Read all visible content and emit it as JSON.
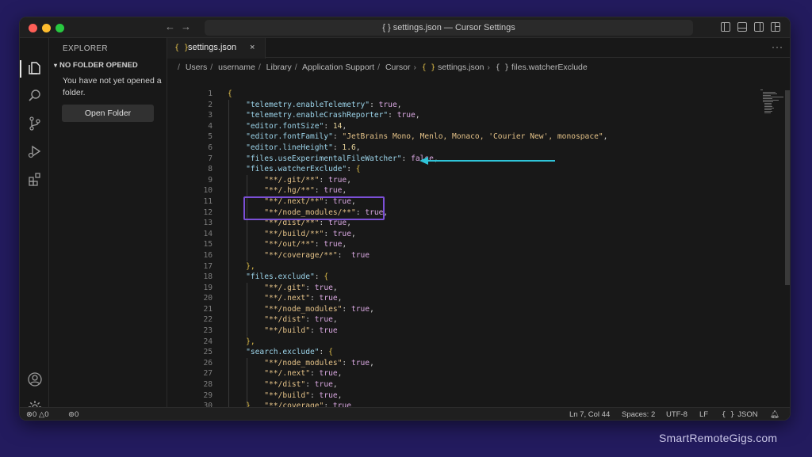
{
  "window": {
    "title": "{ } settings.json — Cursor Settings"
  },
  "sidebar": {
    "title": "EXPLORER",
    "section": "NO FOLDER OPENED",
    "message": "You have not yet opened a folder.",
    "open_folder_label": "Open Folder"
  },
  "tab": {
    "braces": "{ }",
    "name": "settings.json",
    "close": "×"
  },
  "breadcrumb": {
    "items": [
      "Users",
      "username",
      "Library",
      "Application Support",
      "Cursor",
      "settings.json",
      "files.watcherExclude"
    ],
    "leading_sep": "/",
    "sep": "/",
    "chevron": "›",
    "braces": "{ }"
  },
  "code_lines": [
    [
      [
        "br",
        "{"
      ]
    ],
    [
      [
        "p",
        "    "
      ],
      [
        "k",
        "\"telemetry.enableTelemetry\""
      ],
      [
        "p",
        ": "
      ],
      [
        "b",
        "true"
      ],
      [
        "p",
        ","
      ]
    ],
    [
      [
        "p",
        "    "
      ],
      [
        "k",
        "\"telemetry.enableCrashReporter\""
      ],
      [
        "p",
        ": "
      ],
      [
        "b",
        "true"
      ],
      [
        "p",
        ","
      ]
    ],
    [
      [
        "p",
        "    "
      ],
      [
        "k",
        "\"editor.fontSize\""
      ],
      [
        "p",
        ": "
      ],
      [
        "n",
        "14"
      ],
      [
        "p",
        ","
      ]
    ],
    [
      [
        "p",
        "    "
      ],
      [
        "k",
        "\"editor.fontFamily\""
      ],
      [
        "p",
        ": "
      ],
      [
        "s",
        "\"JetBrains Mono, Menlo, Monaco, 'Courier New', monospace\""
      ],
      [
        "p",
        ","
      ]
    ],
    [
      [
        "p",
        "    "
      ],
      [
        "k",
        "\"editor.lineHeight\""
      ],
      [
        "p",
        ": "
      ],
      [
        "n",
        "1.6"
      ],
      [
        "p",
        ","
      ]
    ],
    [
      [
        "p",
        "    "
      ],
      [
        "k",
        "\"files.useExperimentalFileWatcher\""
      ],
      [
        "p",
        ": "
      ],
      [
        "b",
        "false"
      ],
      [
        "p",
        ","
      ]
    ],
    [
      [
        "p",
        "    "
      ],
      [
        "k",
        "\"files.watcherExclude\""
      ],
      [
        "p",
        ": "
      ],
      [
        "br",
        "{"
      ]
    ],
    [
      [
        "p",
        "        "
      ],
      [
        "s",
        "\"**/.git/**\""
      ],
      [
        "p",
        ": "
      ],
      [
        "b",
        "true"
      ],
      [
        "p",
        ","
      ]
    ],
    [
      [
        "p",
        "        "
      ],
      [
        "s",
        "\"**/.hg/**\""
      ],
      [
        "p",
        ": "
      ],
      [
        "b",
        "true"
      ],
      [
        "p",
        ","
      ]
    ],
    [
      [
        "p",
        "        "
      ],
      [
        "s",
        "\"**/.next/**\""
      ],
      [
        "p",
        ": "
      ],
      [
        "b",
        "true"
      ],
      [
        "p",
        ","
      ]
    ],
    [
      [
        "p",
        "        "
      ],
      [
        "s",
        "\"**/node_modules/**\""
      ],
      [
        "p",
        ": "
      ],
      [
        "b",
        "true"
      ],
      [
        "p",
        ","
      ]
    ],
    [
      [
        "p",
        "        "
      ],
      [
        "s",
        "\"**/dist/**\""
      ],
      [
        "p",
        ": "
      ],
      [
        "b",
        "true"
      ],
      [
        "p",
        ","
      ]
    ],
    [
      [
        "p",
        "        "
      ],
      [
        "s",
        "\"**/build/**\""
      ],
      [
        "p",
        ": "
      ],
      [
        "b",
        "true"
      ],
      [
        "p",
        ","
      ]
    ],
    [
      [
        "p",
        "        "
      ],
      [
        "s",
        "\"**/out/**\""
      ],
      [
        "p",
        ": "
      ],
      [
        "b",
        "true"
      ],
      [
        "p",
        ","
      ]
    ],
    [
      [
        "p",
        "        "
      ],
      [
        "s",
        "\"**/coverage/**\""
      ],
      [
        "p",
        ":  "
      ],
      [
        "b",
        "true"
      ]
    ],
    [
      [
        "p",
        "    "
      ],
      [
        "br",
        "},"
      ]
    ],
    [
      [
        "p",
        "    "
      ],
      [
        "k",
        "\"files.exclude\""
      ],
      [
        "p",
        ": "
      ],
      [
        "br",
        "{"
      ]
    ],
    [
      [
        "p",
        "        "
      ],
      [
        "s",
        "\"**/.git\""
      ],
      [
        "p",
        ": "
      ],
      [
        "b",
        "true"
      ],
      [
        "p",
        ","
      ]
    ],
    [
      [
        "p",
        "        "
      ],
      [
        "s",
        "\"**/.next\""
      ],
      [
        "p",
        ": "
      ],
      [
        "b",
        "true"
      ],
      [
        "p",
        ","
      ]
    ],
    [
      [
        "p",
        "        "
      ],
      [
        "s",
        "\"**/node_modules\""
      ],
      [
        "p",
        ": "
      ],
      [
        "b",
        "true"
      ],
      [
        "p",
        ","
      ]
    ],
    [
      [
        "p",
        "        "
      ],
      [
        "s",
        "\"**/dist\""
      ],
      [
        "p",
        ": "
      ],
      [
        "b",
        "true"
      ],
      [
        "p",
        ","
      ]
    ],
    [
      [
        "p",
        "        "
      ],
      [
        "s",
        "\"**/build\""
      ],
      [
        "p",
        ": "
      ],
      [
        "b",
        "true"
      ]
    ],
    [
      [
        "p",
        "    "
      ],
      [
        "br",
        "},"
      ]
    ],
    [
      [
        "p",
        "    "
      ],
      [
        "k",
        "\"search.exclude\""
      ],
      [
        "p",
        ": "
      ],
      [
        "br",
        "{"
      ]
    ],
    [
      [
        "p",
        "        "
      ],
      [
        "s",
        "\"**/node_modules\""
      ],
      [
        "p",
        ": "
      ],
      [
        "b",
        "true"
      ],
      [
        "p",
        ","
      ]
    ],
    [
      [
        "p",
        "        "
      ],
      [
        "s",
        "\"**/.next\""
      ],
      [
        "p",
        ": "
      ],
      [
        "b",
        "true"
      ],
      [
        "p",
        ","
      ]
    ],
    [
      [
        "p",
        "        "
      ],
      [
        "s",
        "\"**/dist\""
      ],
      [
        "p",
        ": "
      ],
      [
        "b",
        "true"
      ],
      [
        "p",
        ","
      ]
    ],
    [
      [
        "p",
        "        "
      ],
      [
        "s",
        "\"**/build\""
      ],
      [
        "p",
        ": "
      ],
      [
        "b",
        "true"
      ],
      [
        "p",
        ","
      ]
    ],
    [
      [
        "p",
        "    "
      ],
      [
        "br",
        "}"
      ],
      [
        "p",
        "   "
      ],
      [
        "s",
        "\"**/coverage\""
      ],
      [
        "p",
        ": "
      ],
      [
        "b",
        "true"
      ]
    ],
    [
      [
        "br",
        "}"
      ]
    ]
  ],
  "status": {
    "errors": "0",
    "warnings": "0",
    "ports": "0",
    "position": "Ln 7, Col 44",
    "spaces": "Spaces: 2",
    "encoding": "UTF-8",
    "eol": "LF",
    "language_braces": "{ }",
    "language": "JSON"
  },
  "watermark": "SmartRemoteGigs.com",
  "colors": {
    "background": "#231b5e",
    "arrow": "#2fc4d8",
    "highlight": "#7b4fd6",
    "traffic_red": "#ff5f57",
    "traffic_yellow": "#febc2e",
    "traffic_green": "#28c840"
  }
}
